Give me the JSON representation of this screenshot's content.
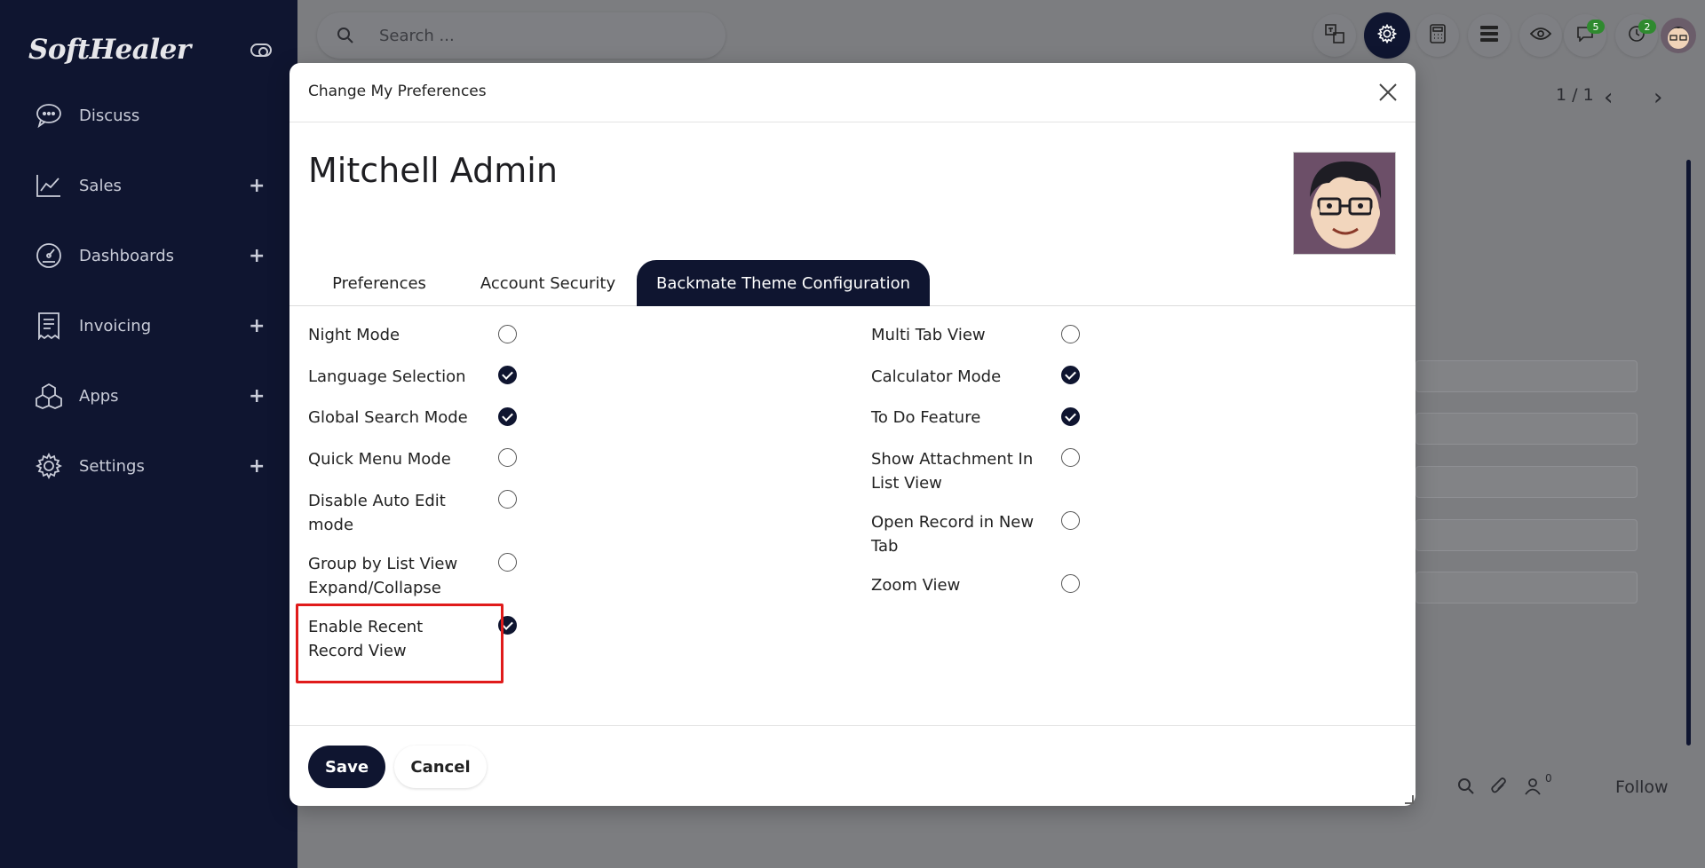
{
  "sidebar": {
    "logo": "SoftHealer",
    "items": [
      {
        "label": "Discuss",
        "has_plus": false
      },
      {
        "label": "Sales",
        "has_plus": true
      },
      {
        "label": "Dashboards",
        "has_plus": true
      },
      {
        "label": "Invoicing",
        "has_plus": true
      },
      {
        "label": "Apps",
        "has_plus": true
      },
      {
        "label": "Settings",
        "has_plus": true
      }
    ],
    "plus": "+"
  },
  "topbar": {
    "search_placeholder": "Search ...",
    "badges": {
      "messages": "5",
      "activities": "2"
    }
  },
  "background": {
    "pager": "1 / 1",
    "followers_count": "0",
    "follow_label": "Follow"
  },
  "modal": {
    "title": "Change My Preferences",
    "user_name": "Mitchell Admin",
    "tabs": [
      {
        "label": "Preferences",
        "active": false
      },
      {
        "label": "Account Security",
        "active": false
      },
      {
        "label": "Backmate Theme Configuration",
        "active": true
      }
    ],
    "left_options": [
      {
        "label": "Night Mode",
        "checked": false
      },
      {
        "label": "Language Selection",
        "checked": true
      },
      {
        "label": "Global Search Mode",
        "checked": true
      },
      {
        "label": "Quick Menu Mode",
        "checked": false
      },
      {
        "label": "Disable Auto Edit mode",
        "checked": false
      },
      {
        "label": "Group by List View Expand/Collapse",
        "checked": false
      },
      {
        "label": "Enable Recent Record View",
        "checked": true
      }
    ],
    "right_options": [
      {
        "label": "Multi Tab View",
        "checked": false
      },
      {
        "label": "Calculator Mode",
        "checked": true
      },
      {
        "label": "To Do Feature",
        "checked": true
      },
      {
        "label": "Show Attachment In List View",
        "checked": false
      },
      {
        "label": "Open Record in New Tab",
        "checked": false
      },
      {
        "label": "Zoom View",
        "checked": false
      }
    ],
    "save_label": "Save",
    "cancel_label": "Cancel"
  },
  "colors": {
    "primary": "#0f1530",
    "highlight": "#e01b1b",
    "badge": "#2f8a2f"
  }
}
